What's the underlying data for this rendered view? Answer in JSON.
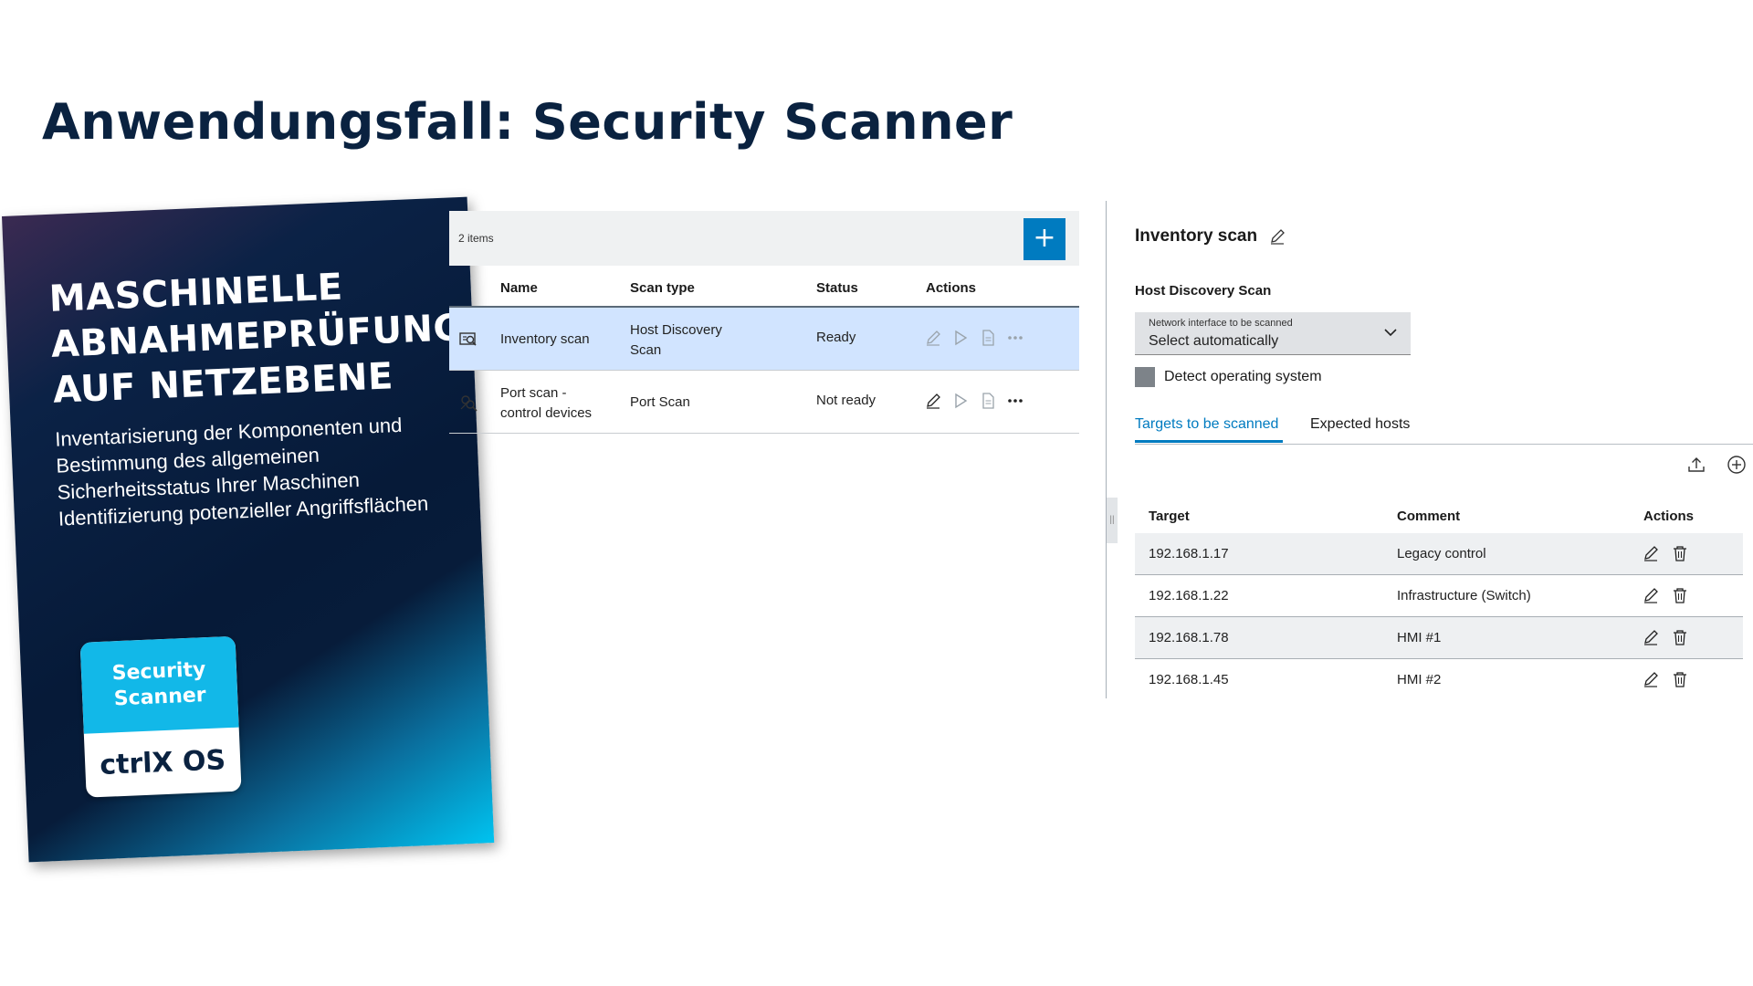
{
  "page": {
    "headline": "Anwendungsfall: Security Scanner"
  },
  "brochure": {
    "title_lines": [
      "MASCHINELLE",
      "ABNAHMEPRÜFUNG",
      "AUF NETZEBENE"
    ],
    "subtitle_lines": [
      "Inventarisierung der Komponenten und",
      "Bestimmung des allgemeinen",
      "Sicherheitsstatus Ihrer Maschinen",
      "Identifizierung potenzieller Angriffsflächen"
    ],
    "badge": {
      "top_lines": [
        "Security",
        "Scanner"
      ],
      "bottom": "ctrlX OS"
    }
  },
  "scan_list": {
    "items_count": "2 items",
    "add_label": "+",
    "columns": [
      "Name",
      "Scan type",
      "Status",
      "Actions"
    ],
    "rows": [
      {
        "name": "Inventory scan",
        "scan_type": "Host Discovery Scan",
        "status": "Ready",
        "icon": "inventory-scan-icon",
        "selected": true
      },
      {
        "name": "Port scan - control devices",
        "scan_type": "Port Scan",
        "status": "Not ready",
        "icon": "port-scan-icon",
        "selected": false
      }
    ]
  },
  "detail": {
    "title": "Inventory scan",
    "section": "Host Discovery Scan",
    "dropdown": {
      "label": "Network interface to be scanned",
      "value": "Select automatically"
    },
    "checkbox_label": "Detect operating system",
    "tabs": [
      "Targets to be scanned",
      "Expected hosts"
    ],
    "active_tab": "Targets to be scanned",
    "table": {
      "columns": [
        "Target",
        "Comment",
        "Actions"
      ],
      "rows": [
        {
          "target": "192.168.1.17",
          "comment": "Legacy control"
        },
        {
          "target": "192.168.1.22",
          "comment": "Infrastructure (Switch)"
        },
        {
          "target": "192.168.1.78",
          "comment": "HMI #1"
        },
        {
          "target": "192.168.1.45",
          "comment": "HMI #2"
        }
      ]
    }
  },
  "colors": {
    "brand_blue": "#007bc0",
    "headline": "#0a2240",
    "selected_row": "#d1e4ff",
    "badge_cyan": "#12b8e8"
  }
}
